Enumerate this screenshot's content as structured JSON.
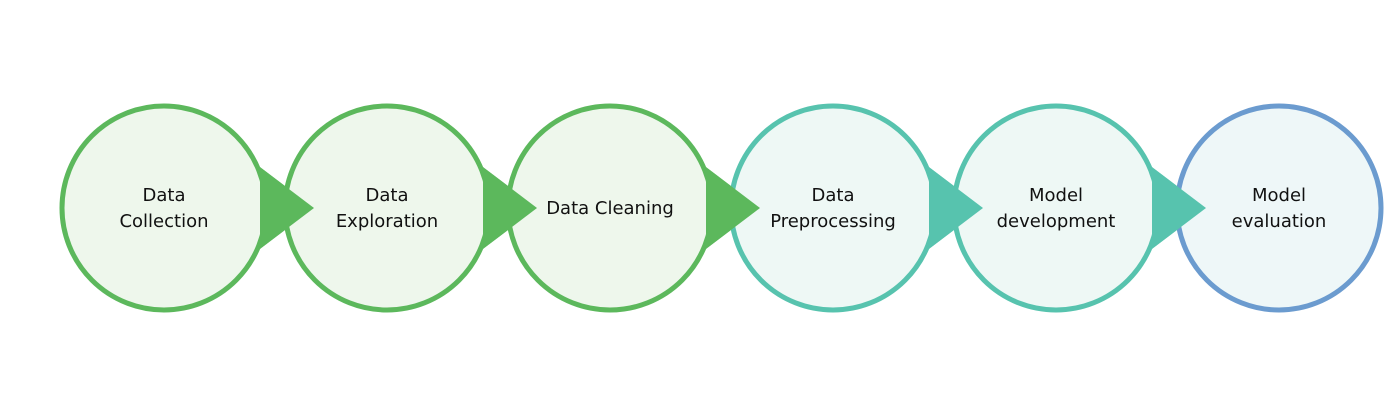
{
  "diagram": {
    "steps": [
      {
        "lines": [
          "Data",
          "Collection"
        ],
        "stroke": "#5cb85c",
        "fill": "#eef7ec"
      },
      {
        "lines": [
          "Data",
          "Exploration"
        ],
        "stroke": "#5cb85c",
        "fill": "#eef7ec"
      },
      {
        "lines": [
          "Data Cleaning"
        ],
        "stroke": "#5cb85c",
        "fill": "#eef7ec"
      },
      {
        "lines": [
          "Data",
          "Preprocessing"
        ],
        "stroke": "#57c3ae",
        "fill": "#eef8f5"
      },
      {
        "lines": [
          "Model",
          "development"
        ],
        "stroke": "#57c3ae",
        "fill": "#eef8f5"
      },
      {
        "lines": [
          "Model",
          "evaluation"
        ],
        "stroke": "#6b9bcf",
        "fill": "#eef7f8"
      }
    ],
    "connector_colors": [
      "#5cb85c",
      "#5cb85c",
      "#5cb85c",
      "#57c3ae",
      "#57c3ae"
    ]
  }
}
